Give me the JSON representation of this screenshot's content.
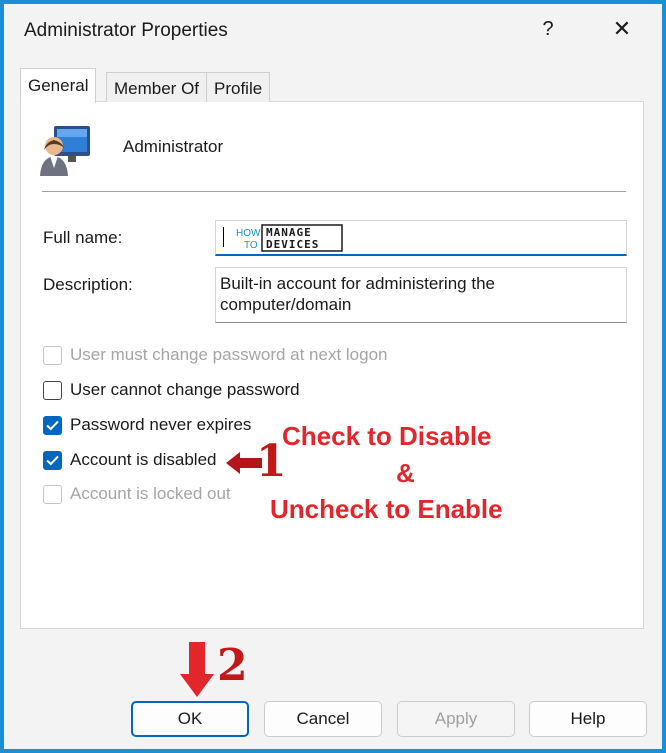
{
  "window": {
    "title": "Administrator Properties",
    "help_glyph": "?",
    "close_glyph": "✕"
  },
  "tabs": [
    {
      "label": "General",
      "active": true
    },
    {
      "label": "Member Of",
      "active": false
    },
    {
      "label": "Profile",
      "active": false
    }
  ],
  "account": {
    "name": "Administrator",
    "icon": "user-monitor-icon"
  },
  "fields": {
    "full_name_label": "Full name:",
    "full_name_value": "",
    "description_label": "Description:",
    "description_value": "Built-in account for administering the computer/domain"
  },
  "watermark": {
    "left": [
      "HOW",
      "TO"
    ],
    "right": [
      "MANAGE",
      "DEVICES"
    ]
  },
  "checkboxes": [
    {
      "label": "User must change password at next logon",
      "checked": false,
      "disabled": true
    },
    {
      "label": "User cannot change password",
      "checked": false,
      "disabled": false
    },
    {
      "label": "Password never expires",
      "checked": true,
      "disabled": false
    },
    {
      "label": "Account is disabled",
      "checked": true,
      "disabled": false
    },
    {
      "label": "Account is locked out",
      "checked": false,
      "disabled": true
    }
  ],
  "annotations": {
    "step1": "1",
    "step2": "2",
    "line1": "Check to Disable",
    "line2": "&",
    "line3": "Uncheck to Enable"
  },
  "buttons": {
    "ok": "OK",
    "cancel": "Cancel",
    "apply": "Apply",
    "help": "Help"
  },
  "colors": {
    "accent": "#0067c0",
    "annotation": "#e3262b",
    "frame": "#1b8ed6"
  }
}
